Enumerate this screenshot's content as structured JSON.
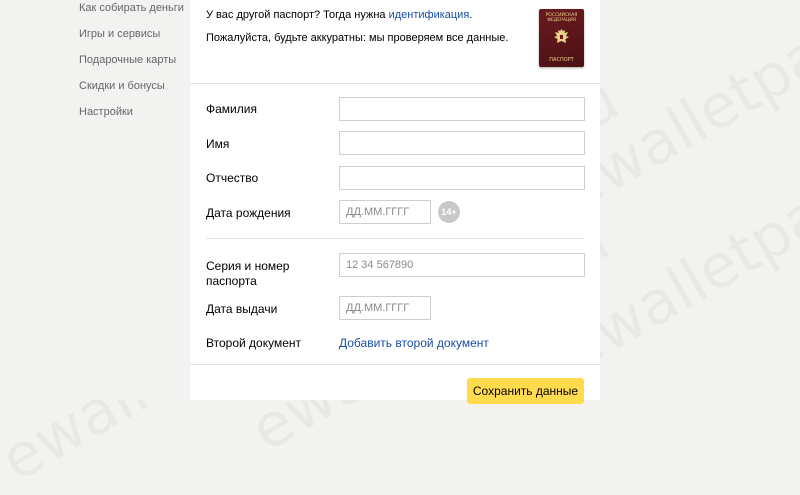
{
  "sidebar": {
    "items": [
      {
        "label": "Как собирать деньги"
      },
      {
        "label": "Игры и сервисы"
      },
      {
        "label": "Подарочные карты"
      },
      {
        "label": "Скидки и бонусы"
      },
      {
        "label": "Настройки"
      }
    ]
  },
  "notice": {
    "line1_prefix": "У вас другой паспорт? Тогда нужна ",
    "line1_link": "идентификация",
    "line1_suffix": ".",
    "line2": "Пожалуйста, будьте аккуратны: мы проверяем все данные."
  },
  "passport_image": {
    "top_text": "РОССИЙСКАЯ ФЕДЕРАЦИЯ",
    "bottom_text": "ПАСПОРТ"
  },
  "form": {
    "surname_label": "Фамилия",
    "surname_value": "",
    "name_label": "Имя",
    "name_value": "",
    "patronymic_label": "Отчество",
    "patronymic_value": "",
    "birthdate_label": "Дата рождения",
    "birthdate_placeholder": "ДД.ММ.ГГГГ",
    "age_badge": "14+",
    "passport_number_label": "Серия и номер паспорта",
    "passport_number_placeholder": "12 34 567890",
    "issue_date_label": "Дата выдачи",
    "issue_date_placeholder": "ДД.ММ.ГГГГ",
    "second_doc_label": "Второй документ",
    "second_doc_link": "Добавить второй документ"
  },
  "save_button": "Сохранить данные",
  "watermark": "ewalletpay.ru"
}
